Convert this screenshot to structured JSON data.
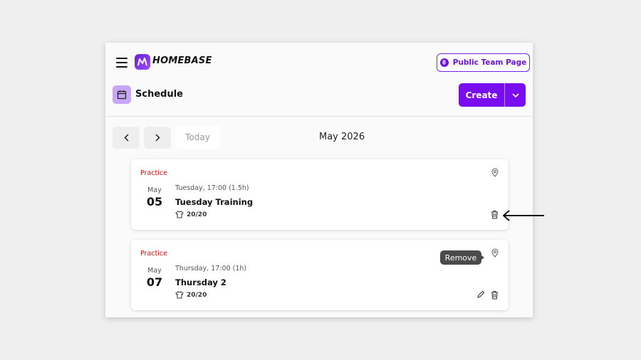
{
  "header": {
    "brand": "HOMEBASE",
    "public_button": "Public Team Page"
  },
  "schedule": {
    "title": "Schedule",
    "create_label": "Create"
  },
  "nav": {
    "today_label": "Today",
    "month_label": "May 2026"
  },
  "events": [
    {
      "category": "Practice",
      "month": "May",
      "day": "05",
      "when": "Tuesday, 17:00 (1.5h)",
      "name": "Tuesday Training",
      "capacity": "20/20"
    },
    {
      "category": "Practice",
      "month": "May",
      "day": "07",
      "when": "Thursday, 17:00 (1h)",
      "name": "Thursday 2",
      "capacity": "20/20"
    }
  ],
  "tooltip": {
    "text": "Remove"
  },
  "colors": {
    "accent": "#7a0df0",
    "category": "#cc1010",
    "schedule_icon_bg": "#c6a6f5"
  },
  "icons": [
    "hamburger-icon",
    "logo-icon",
    "globe-icon",
    "calendar-icon",
    "chevron-down-icon",
    "chevron-left-icon",
    "chevron-right-icon",
    "location-pin-icon",
    "shirt-icon",
    "trash-icon",
    "pencil-icon",
    "arrow-left-icon"
  ]
}
